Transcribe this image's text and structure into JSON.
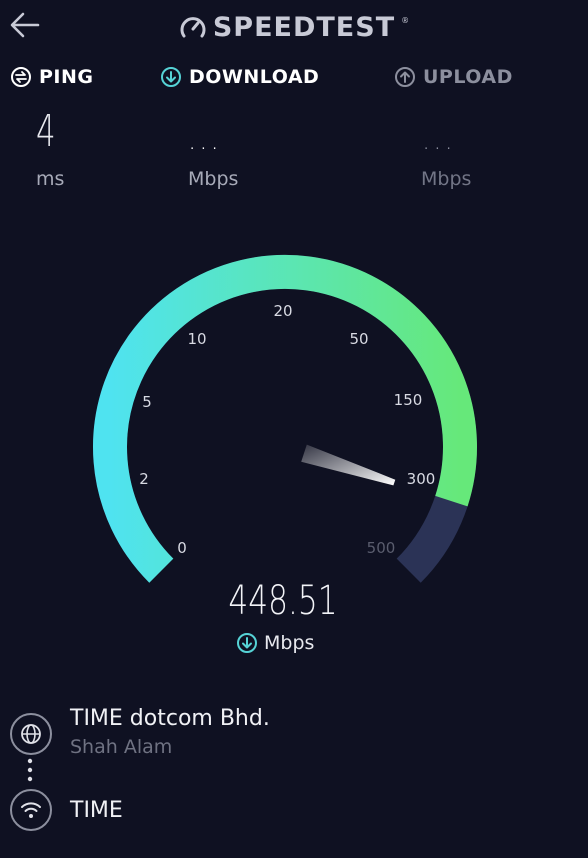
{
  "header": {
    "brand": "SPEEDTEST",
    "brand_mark": "®",
    "back_icon": "arrow-left-icon",
    "logo_icon": "gauge-logo-icon"
  },
  "metrics": {
    "ping": {
      "label": "PING",
      "value": "4",
      "unit": "ms",
      "icon": "ping-icon"
    },
    "download": {
      "label": "DOWNLOAD",
      "value": "...",
      "unit": "Mbps",
      "icon": "download-circle-icon"
    },
    "upload": {
      "label": "UPLOAD",
      "value": "...",
      "unit": "Mbps",
      "icon": "upload-circle-icon"
    }
  },
  "gauge": {
    "ticks": [
      "0",
      "2",
      "5",
      "10",
      "20",
      "50",
      "150",
      "300",
      "500"
    ],
    "current_speed": "448.51",
    "speed_unit": "Mbps",
    "needle_fraction": 0.9,
    "colors": {
      "start": "#4fe3f0",
      "end": "#66e87a",
      "track": "#2b3356",
      "needle": "#ffffff",
      "accent": "#56d3d6"
    }
  },
  "server": {
    "isp": "TIME dotcom Bhd.",
    "location": "Shah Alam",
    "connection": "TIME",
    "globe_icon": "globe-icon",
    "wifi_icon": "wifi-icon"
  }
}
